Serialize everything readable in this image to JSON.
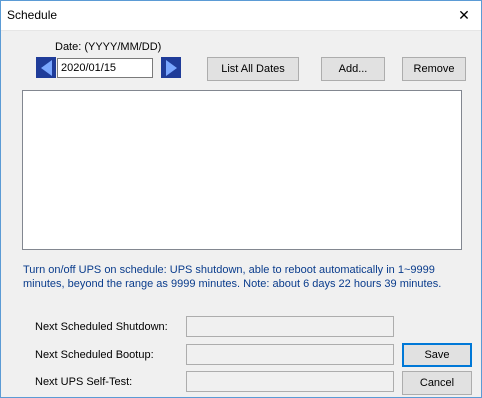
{
  "window": {
    "title": "Schedule",
    "close_glyph": "✕"
  },
  "date": {
    "label": "Date:  (YYYY/MM/DD)",
    "value": "2020/01/15"
  },
  "buttons": {
    "list_all_dates": "List All Dates",
    "add": "Add...",
    "remove": "Remove",
    "save": "Save",
    "cancel": "Cancel"
  },
  "info_text": "Turn on/off UPS on schedule: UPS shutdown, able to reboot automatically in 1~9999 minutes, beyond the range as 9999 minutes. Note: about 6 days 22 hours 39 minutes.",
  "fields": {
    "next_shutdown_label": "Next Scheduled Shutdown:",
    "next_bootup_label": "Next Scheduled Bootup:",
    "next_selftest_label": "Next UPS Self-Test:",
    "next_shutdown_value": "",
    "next_bootup_value": "",
    "next_selftest_value": ""
  },
  "colors": {
    "info_text": "#0a3c8c",
    "arrow_bg": "#1f3c99",
    "arrow_fg": "#7aa7ff",
    "window_border": "#5b9bd5"
  }
}
